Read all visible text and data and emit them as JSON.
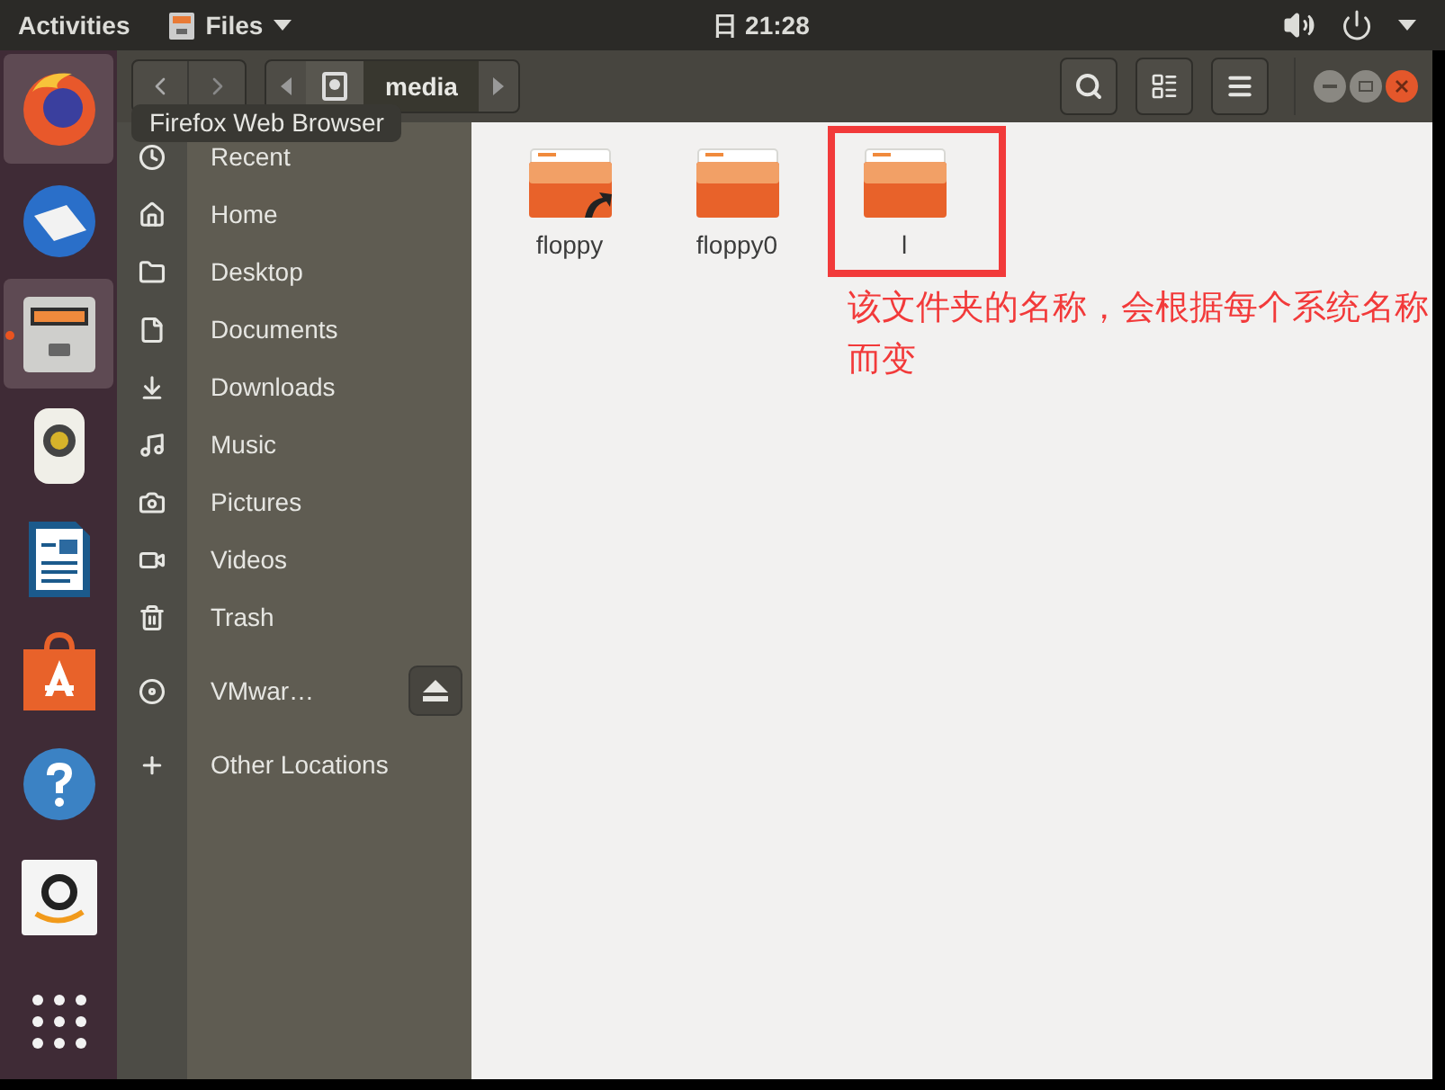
{
  "top_bar": {
    "activities": "Activities",
    "app_menu": "Files",
    "clock": "日 21:28"
  },
  "dock": [
    {
      "kind": "firefox",
      "hovered": true,
      "running": false
    },
    {
      "kind": "mail",
      "hovered": false,
      "running": false
    },
    {
      "kind": "files",
      "hovered": false,
      "running": true
    },
    {
      "kind": "speaker",
      "hovered": false,
      "running": false
    },
    {
      "kind": "writer",
      "hovered": false,
      "running": false
    },
    {
      "kind": "store",
      "hovered": false,
      "running": false
    },
    {
      "kind": "help",
      "hovered": false,
      "running": false
    },
    {
      "kind": "shop",
      "hovered": false,
      "running": false
    },
    {
      "kind": "grid",
      "hovered": false,
      "running": false
    }
  ],
  "tooltip": "Firefox Web Browser",
  "path": [
    {
      "kind": "drive",
      "selected": false
    },
    {
      "kind": "text",
      "label": "media",
      "selected": true
    }
  ],
  "sidebar": {
    "places": [
      {
        "label": "Recent"
      },
      {
        "label": "Home"
      },
      {
        "label": "Desktop"
      },
      {
        "label": "Documents"
      },
      {
        "label": "Downloads"
      },
      {
        "label": "Music"
      },
      {
        "label": "Pictures"
      },
      {
        "label": "Videos"
      },
      {
        "label": "Trash"
      }
    ],
    "devices": [
      {
        "label": "VMwar…"
      }
    ],
    "other": [
      {
        "label": "Other Locations"
      }
    ]
  },
  "files": [
    {
      "name": "floppy",
      "link": true
    },
    {
      "name": "floppy0",
      "link": false
    },
    {
      "name": "l",
      "link": false
    }
  ],
  "annotation": {
    "text": "该文件夹的名称，会根据每个系统名称而变"
  }
}
